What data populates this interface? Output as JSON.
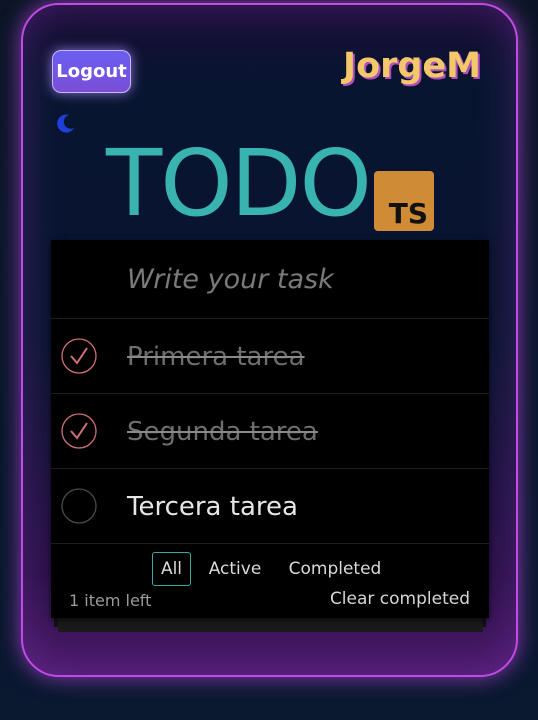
{
  "header": {
    "logout_label": "Logout",
    "username": "JorgeM",
    "theme_icon": "moon-icon"
  },
  "title": {
    "text": "TODO",
    "badge": "TS"
  },
  "new_task": {
    "placeholder": "Write your task"
  },
  "tasks": [
    {
      "label": "Primera tarea",
      "completed": true
    },
    {
      "label": "Segunda tarea",
      "completed": true
    },
    {
      "label": "Tercera tarea",
      "completed": false
    }
  ],
  "footer": {
    "items_left": "1 item left",
    "filters": [
      "All",
      "Active",
      "Completed"
    ],
    "active_filter": "All",
    "clear_label": "Clear completed"
  },
  "colors": {
    "accent": "#39b3b0",
    "check": "#d0707a",
    "badge": "#d08b36",
    "border_glow": "#c04be6"
  }
}
